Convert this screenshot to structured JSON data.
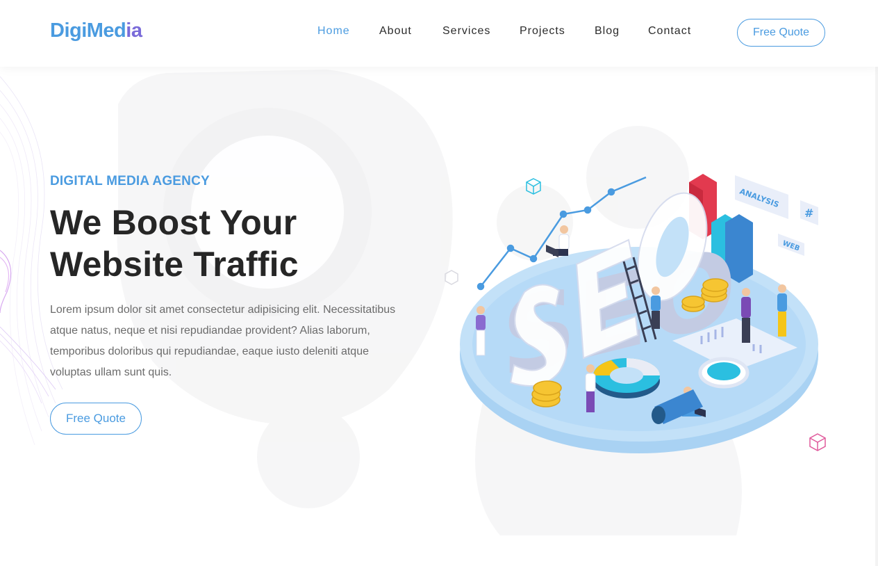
{
  "brand": {
    "name_main": "DigiMed",
    "name_accent": "ia"
  },
  "nav": {
    "items": [
      {
        "label": "Home",
        "active": true
      },
      {
        "label": "About",
        "active": false
      },
      {
        "label": "Services",
        "active": false
      },
      {
        "label": "Projects",
        "active": false
      },
      {
        "label": "Blog",
        "active": false
      },
      {
        "label": "Contact",
        "active": false
      }
    ],
    "cta_label": "Free Quote"
  },
  "hero": {
    "eyebrow": "DIGITAL MEDIA AGENCY",
    "headline_line1": "We Boost Your",
    "headline_line2": "Website Traffic",
    "lead": "Lorem ipsum dolor sit amet consectetur adipisicing elit. Necessitatibus atque natus, neque et nisi repudiandae provident? Alias laborum, temporibus doloribus qui repudiandae, eaque iusto deleniti atque voluptas ullam sunt quis.",
    "cta_label": "Free Quote"
  },
  "illustration": {
    "big_word": "SEO",
    "tags": [
      "ANALYSIS",
      "#",
      "WEB"
    ],
    "coin_symbol": "$"
  },
  "colors": {
    "brand_blue": "#4a9be0",
    "brand_purple": "#7a6bd9",
    "heading": "#262626",
    "body_text": "#6b6b6b"
  }
}
